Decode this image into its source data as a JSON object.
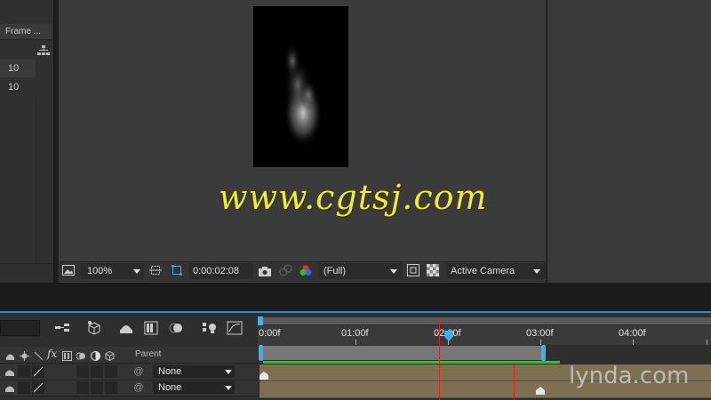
{
  "project_panel": {
    "column_header": "Frame ...",
    "rows": [
      {
        "value": "10"
      },
      {
        "value": "10"
      }
    ]
  },
  "viewer": {
    "watermark": "www.cgtsj.com",
    "toolbar": {
      "zoom": "100%",
      "timecode": "0:00:02:08",
      "resolution": "(Full)",
      "camera": "Active Camera"
    }
  },
  "timeline": {
    "ruler_labels": [
      "0:00f",
      "01:00f",
      "02:00f",
      "03:00f",
      "04:00f"
    ],
    "header": {
      "parent_label": "Parent"
    },
    "layers": [
      {
        "parent": "None"
      },
      {
        "parent": "None"
      }
    ],
    "brand": "lynda.com",
    "colors": {
      "accent": "#3bb2ea",
      "playhead": "#dd2222",
      "layer_bar": "#7d6f52",
      "green_bar": "#2fbf2f"
    }
  }
}
